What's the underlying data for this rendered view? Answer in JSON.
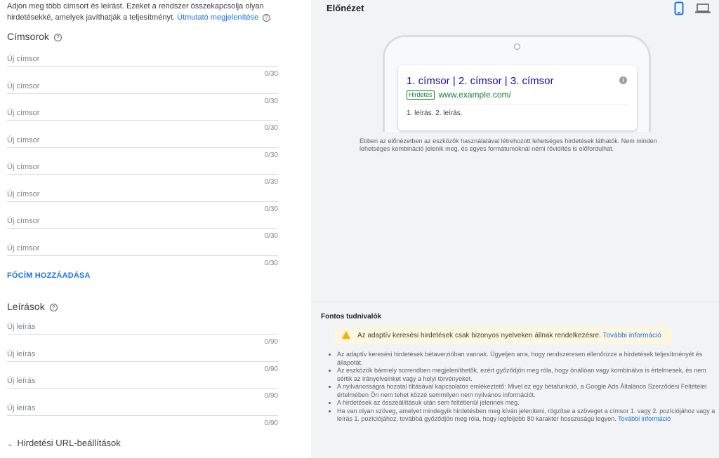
{
  "intro": {
    "text": "Adjon meg több címsort és leírást. Ezeket a rendszer összekapcsolja olyan hirdetésekké, amelyek javíthatják a teljesítményt.",
    "link": "Útmutató megjelenítése"
  },
  "headlines": {
    "title": "Címsorok",
    "items": [
      {
        "placeholder": "Új címsor",
        "count": "0/30"
      },
      {
        "placeholder": "Új címsor",
        "count": "0/30"
      },
      {
        "placeholder": "Új címsor",
        "count": "0/30"
      },
      {
        "placeholder": "Új címsor",
        "count": "0/30"
      },
      {
        "placeholder": "Új címsor",
        "count": "0/30"
      },
      {
        "placeholder": "Új címsor",
        "count": "0/30"
      },
      {
        "placeholder": "Új címsor",
        "count": "0/30"
      },
      {
        "placeholder": "Új címsor",
        "count": "0/30"
      }
    ],
    "add_label": "FŐCÍM HOZZÁADÁSA"
  },
  "descriptions": {
    "title": "Leírások",
    "items": [
      {
        "placeholder": "Új leírás",
        "count": "0/90"
      },
      {
        "placeholder": "Új leírás",
        "count": "0/90"
      },
      {
        "placeholder": "Új leírás",
        "count": "0/90"
      },
      {
        "placeholder": "Új leírás",
        "count": "0/90"
      }
    ]
  },
  "url_settings": {
    "label": "Hirdetési URL-beállítások"
  },
  "preview": {
    "title": "Előnézet",
    "headline": "1. címsor | 2. címsor | 3. címsor",
    "badge": "Hirdetés",
    "url": "www.example.com/",
    "desc": "1. leírás. 2. leírás.",
    "note": "Ebben az előnézetben az eszközök használatával létrehozott lehetséges hirdetések láthatók. Nem minden lehetséges kombináció jelenik meg, és egyes formátumoknál némi rövidítés is előfordulhat.",
    "accent": "#1a73e8"
  },
  "important": {
    "title": "Fontos tudnivalók",
    "warning": "Az adaptív keresési hirdetések csak bizonyos nyelveken állnak rendelkezésre.",
    "warning_link": "További információ",
    "bullets": [
      "Az adaptív keresési hirdetések bétaverzióban vannak. Ügyeljen arra, hogy rendszeresen ellenőrizze a hirdetések teljesítményét és állapotát.",
      "Az eszközök bármely sorrendben megjeleníthetők, ezért győződjön meg róla, hogy önállóan vagy kombinálva is értelmesek, és nem sértik az irányelveinket vagy a helyi törvényeket.",
      "A nyilvánosságra hozatal tiltásával kapcsolatos emlékeztető: Mivel ez egy bétafunkció, a Google Ads Általános Szerződési Feltételei értelmében Ön nem tehet közzé semmilyen nem nyilvános információt.",
      "A hirdetések az összeállításuk után sem feltétlenül jelennek meg.",
      "Ha van olyan szöveg, amelyet mindegyik hirdetésben meg kíván jeleníteni, rögzítse a szöveget a címsor 1. vagy 2. pozíciójához vagy a leírás 1. pozíciójához, továbbá győződjön meg róla, hogy legfeljebb 80 karakter hosszúságú legyen."
    ],
    "last_link": "További információ"
  }
}
